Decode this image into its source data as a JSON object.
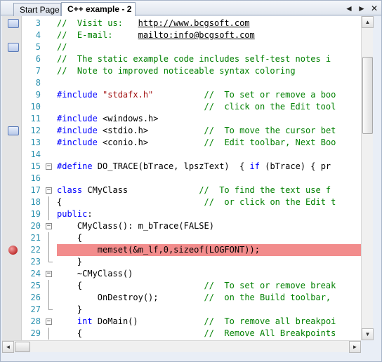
{
  "tabs": [
    {
      "label": "Start Page",
      "active": false
    },
    {
      "label": "C++ example - 2",
      "active": true
    }
  ],
  "tab_controls": {
    "prev": "◄",
    "next": "►",
    "close": "✕"
  },
  "scrollbar_glyphs": {
    "up": "▲",
    "down": "▼",
    "left": "◄",
    "right": "►"
  },
  "fold_glyphs": {
    "collapse": "−"
  },
  "colors": {
    "comment": "#008000",
    "keyword": "#0000ff",
    "string": "#a31515",
    "line_number": "#2b91af",
    "breakpoint_line": "#f28c8c"
  },
  "code_lines": [
    {
      "n": "3",
      "marker": "bookmark",
      "fold": "",
      "segs": [
        {
          "t": "//  Visit us:   ",
          "c": "cm"
        },
        {
          "t": "http://www.bcgsoft.com",
          "c": "ul"
        }
      ]
    },
    {
      "n": "4",
      "marker": "",
      "fold": "",
      "segs": [
        {
          "t": "//  E-mail:     ",
          "c": "cm"
        },
        {
          "t": "mailto:info@bcgsoft.com",
          "c": "ul"
        }
      ]
    },
    {
      "n": "5",
      "marker": "bookmark",
      "fold": "",
      "segs": [
        {
          "t": "//",
          "c": "cm"
        }
      ]
    },
    {
      "n": "6",
      "marker": "",
      "fold": "",
      "segs": [
        {
          "t": "//  The static example code includes self-test notes i",
          "c": "cm"
        }
      ]
    },
    {
      "n": "7",
      "marker": "",
      "fold": "",
      "segs": [
        {
          "t": "//  Note to improved noticeable syntax coloring",
          "c": "cm"
        }
      ]
    },
    {
      "n": "8",
      "marker": "",
      "fold": "",
      "segs": []
    },
    {
      "n": "9",
      "marker": "",
      "fold": "",
      "segs": [
        {
          "t": "#include ",
          "c": "pp"
        },
        {
          "t": "\"stdafx.h\"",
          "c": "st"
        },
        {
          "t": "          ",
          "c": ""
        },
        {
          "t": "//  To set or remove a boo",
          "c": "cm"
        }
      ]
    },
    {
      "n": "10",
      "marker": "",
      "fold": "",
      "segs": [
        {
          "t": "                             ",
          "c": ""
        },
        {
          "t": "//  click on the Edit tool",
          "c": "cm"
        }
      ]
    },
    {
      "n": "11",
      "marker": "",
      "fold": "",
      "segs": [
        {
          "t": "#include ",
          "c": "pp"
        },
        {
          "t": "<windows.h>",
          "c": ""
        }
      ]
    },
    {
      "n": "12",
      "marker": "bookmark",
      "fold": "",
      "segs": [
        {
          "t": "#include ",
          "c": "pp"
        },
        {
          "t": "<stdio.h>",
          "c": ""
        },
        {
          "t": "           ",
          "c": ""
        },
        {
          "t": "//  To move the cursor bet",
          "c": "cm"
        }
      ]
    },
    {
      "n": "13",
      "marker": "",
      "fold": "",
      "segs": [
        {
          "t": "#include ",
          "c": "pp"
        },
        {
          "t": "<conio.h>",
          "c": ""
        },
        {
          "t": "           ",
          "c": ""
        },
        {
          "t": "//  Edit toolbar, Next Boo",
          "c": "cm"
        }
      ]
    },
    {
      "n": "14",
      "marker": "",
      "fold": "",
      "segs": []
    },
    {
      "n": "15",
      "marker": "",
      "fold": "box",
      "segs": [
        {
          "t": "#define ",
          "c": "pp"
        },
        {
          "t": "DO_TRACE(bTrace, lpszText)  { ",
          "c": ""
        },
        {
          "t": "if",
          "c": "kw"
        },
        {
          "t": " (bTrace) { pr",
          "c": ""
        }
      ]
    },
    {
      "n": "16",
      "marker": "",
      "fold": "",
      "segs": []
    },
    {
      "n": "17",
      "marker": "",
      "fold": "box",
      "segs": [
        {
          "t": "class",
          "c": "kw"
        },
        {
          "t": " CMyClass",
          "c": ""
        },
        {
          "t": "              ",
          "c": ""
        },
        {
          "t": "//  To find the text use f",
          "c": "cm"
        }
      ]
    },
    {
      "n": "18",
      "marker": "",
      "fold": "line",
      "segs": [
        {
          "t": "{",
          "c": ""
        },
        {
          "t": "                            ",
          "c": ""
        },
        {
          "t": "//  or click on the Edit t",
          "c": "cm"
        }
      ]
    },
    {
      "n": "19",
      "marker": "",
      "fold": "line",
      "segs": [
        {
          "t": "public",
          "c": "kw"
        },
        {
          "t": ":",
          "c": ""
        }
      ]
    },
    {
      "n": "20",
      "marker": "",
      "fold": "box",
      "segs": [
        {
          "t": "    CMyClass(): m_bTrace(FALSE)",
          "c": ""
        }
      ]
    },
    {
      "n": "21",
      "marker": "",
      "fold": "line",
      "segs": [
        {
          "t": "    {",
          "c": ""
        }
      ]
    },
    {
      "n": "22",
      "marker": "breakpoint",
      "fold": "line",
      "segs": [
        {
          "t": "        memset(&m_lf,0,sizeof(LOGFONT));",
          "c": ""
        }
      ]
    },
    {
      "n": "23",
      "marker": "",
      "fold": "end",
      "segs": [
        {
          "t": "    }",
          "c": ""
        }
      ]
    },
    {
      "n": "24",
      "marker": "",
      "fold": "box",
      "segs": [
        {
          "t": "    ~CMyClass()",
          "c": ""
        }
      ]
    },
    {
      "n": "25",
      "marker": "",
      "fold": "line",
      "segs": [
        {
          "t": "    {",
          "c": ""
        },
        {
          "t": "                        ",
          "c": ""
        },
        {
          "t": "//  To set or remove break",
          "c": "cm"
        }
      ]
    },
    {
      "n": "26",
      "marker": "",
      "fold": "line",
      "segs": [
        {
          "t": "        OnDestroy();",
          "c": ""
        },
        {
          "t": "         ",
          "c": ""
        },
        {
          "t": "//  on the Build toolbar,",
          "c": "cm"
        }
      ]
    },
    {
      "n": "27",
      "marker": "",
      "fold": "end",
      "segs": [
        {
          "t": "    }",
          "c": ""
        }
      ]
    },
    {
      "n": "28",
      "marker": "",
      "fold": "box",
      "segs": [
        {
          "t": "    ",
          "c": ""
        },
        {
          "t": "int",
          "c": "kw"
        },
        {
          "t": " DoMain()",
          "c": ""
        },
        {
          "t": "             ",
          "c": ""
        },
        {
          "t": "//  To remove all breakpoi",
          "c": "cm"
        }
      ]
    },
    {
      "n": "29",
      "marker": "",
      "fold": "line",
      "segs": [
        {
          "t": "    {",
          "c": ""
        },
        {
          "t": "                        ",
          "c": ""
        },
        {
          "t": "//  Remove All Breakpoints",
          "c": "cm"
        }
      ]
    }
  ]
}
